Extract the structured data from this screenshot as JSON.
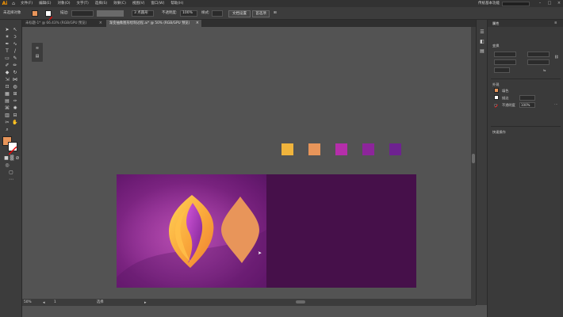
{
  "app": {
    "logo": "Ai",
    "workspace": "传统基本功能"
  },
  "menu": [
    "文件(F)",
    "编辑(E)",
    "对象(O)",
    "文字(T)",
    "选择(S)",
    "效果(C)",
    "视图(V)",
    "窗口(W)",
    "帮助(H)"
  ],
  "control": {
    "selection_label": "未选择对象",
    "stroke_label": "描边:",
    "stroke_value": "",
    "brush_value": "3 点圆形",
    "opacity_label": "不透明度:",
    "opacity_value": "100%",
    "style_label": "样式:",
    "doc_setup": "文档设置",
    "prefs": "首选项"
  },
  "tabs": [
    {
      "label": "未标题-1* @ 66.43% (RGB/GPU 预览)",
      "close": "×"
    },
    {
      "label": "渐变抽象图形绘制过程.ai* @ 50% (RGB/GPU 预览)",
      "close": "×"
    }
  ],
  "panel": {
    "title": "属性",
    "transform": "变换",
    "appearance": "外观",
    "fill_label": "填色",
    "stroke_label": "描边",
    "opacity_label": "不透明度",
    "opacity_value": "100%",
    "quick_actions": "快速操作"
  },
  "status": {
    "zoom": "50%",
    "artboard_num": "1",
    "tool_name": "选择"
  },
  "colors": {
    "fill": "#e8955a",
    "swatches": [
      "#f0b43c",
      "#e8955a",
      "#b52eaa",
      "#8d259b",
      "#6e2290"
    ]
  },
  "icons": {
    "home": "home-icon",
    "search": "search-icon"
  }
}
